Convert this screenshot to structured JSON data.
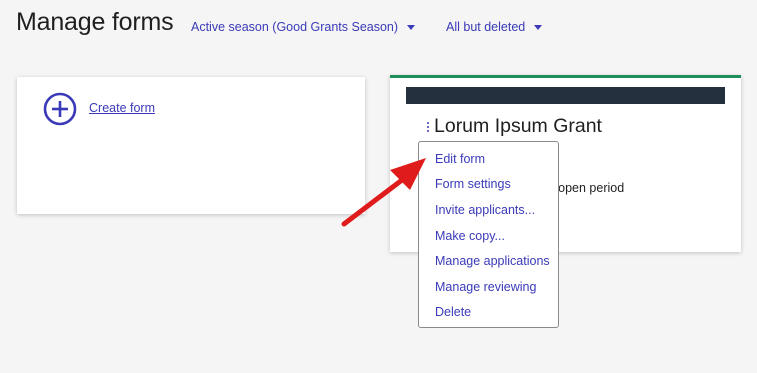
{
  "page": {
    "title": "Manage forms"
  },
  "filters": {
    "season": "Active season (Good Grants Season)",
    "status": "All but deleted"
  },
  "create_card": {
    "link_label": "Create form",
    "icon": "plus-circle-icon"
  },
  "form_card": {
    "title": "Lorum Ipsum Grant",
    "period_text": "ion open period",
    "kebab_icon": "vertical-ellipsis-icon"
  },
  "menu": {
    "items": [
      "Edit form",
      "Form settings",
      "Invite applicants...",
      "Make copy...",
      "Manage applications",
      "Manage reviewing",
      "Delete"
    ]
  },
  "colors": {
    "accent": "#3a3ab8",
    "card_top_border": "#1e8e5a",
    "banner": "#24303d",
    "annotation_arrow": "#e01b1b"
  }
}
